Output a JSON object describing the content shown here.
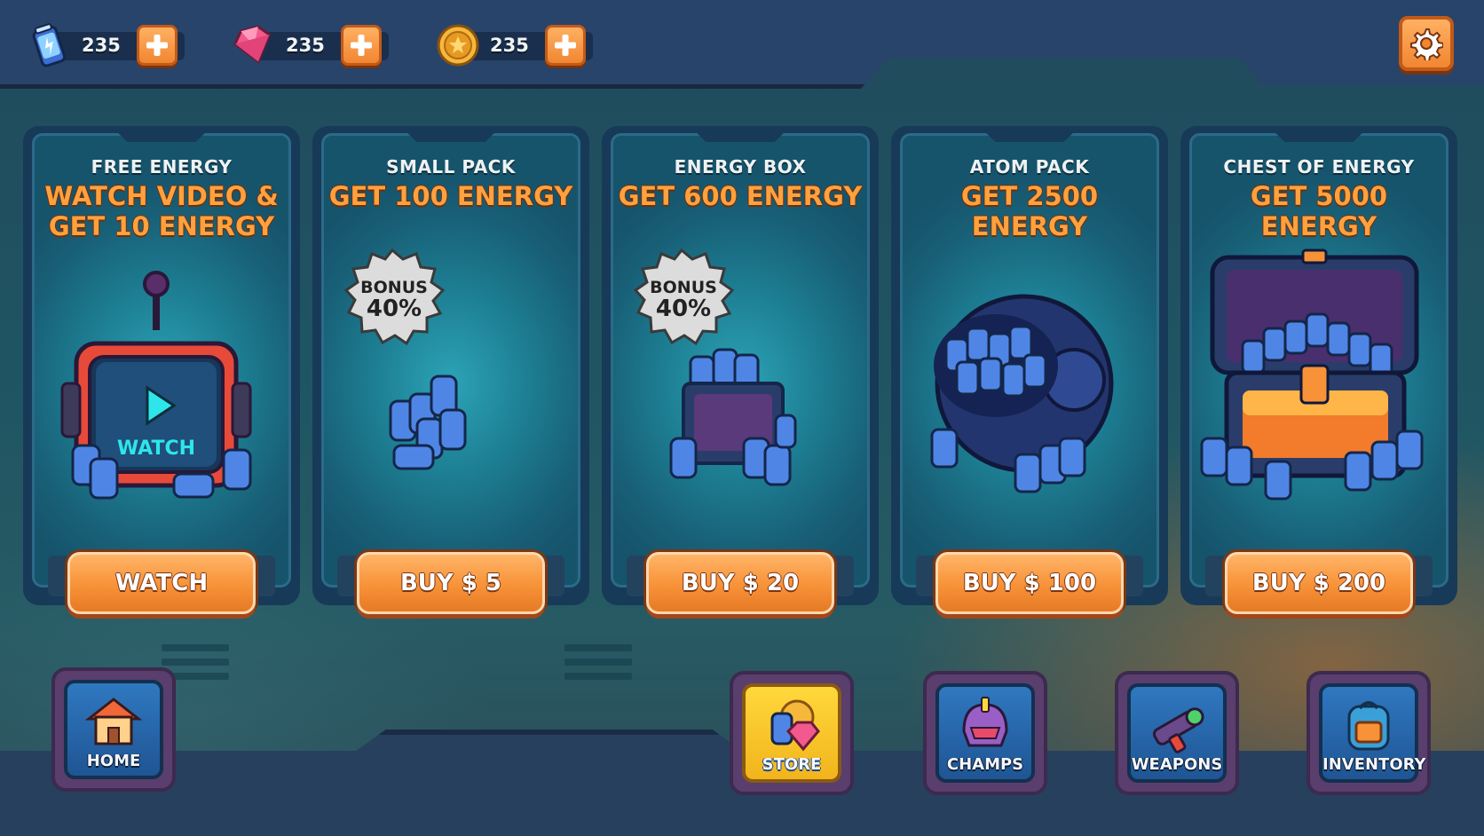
{
  "currencies": [
    {
      "name": "energy",
      "icon": "energy-battery-icon",
      "value": "235"
    },
    {
      "name": "gems",
      "icon": "pink-gem-icon",
      "value": "235"
    },
    {
      "name": "coins",
      "icon": "gold-coin-icon",
      "value": "235"
    }
  ],
  "settings": {
    "icon": "gear-icon"
  },
  "cards": [
    {
      "subtitle": "FREE ENERGY",
      "title_line1": "WATCH VIDEO &",
      "title_line2": "GET 10 ENERGY",
      "button": "WATCH",
      "bonus": ""
    },
    {
      "subtitle": "SMALL PACK",
      "title_line1": "GET 100 ENERGY",
      "title_line2": "",
      "button": "BUY $ 5",
      "bonus_word": "BONUS",
      "bonus_value": "40%"
    },
    {
      "subtitle": "ENERGY BOX",
      "title_line1": "GET 600 ENERGY",
      "title_line2": "",
      "button": "BUY $ 20",
      "bonus_word": "BONUS",
      "bonus_value": "40%"
    },
    {
      "subtitle": "ATOM PACK",
      "title_line1": "GET 2500 ENERGY",
      "title_line2": "",
      "button": "BUY $ 100"
    },
    {
      "subtitle": "CHEST OF ENERGY",
      "title_line1": "GET 5000 ENERGY",
      "title_line2": "",
      "button": "BUY $ 200"
    }
  ],
  "tv_label": "WATCH",
  "nav": [
    {
      "label": "HOME",
      "icon": "home-icon",
      "active": false
    },
    {
      "label": "STORE",
      "icon": "store-icon",
      "active": true
    },
    {
      "label": "CHAMPS",
      "icon": "champs-helmet-icon",
      "active": false
    },
    {
      "label": "WEAPONS",
      "icon": "weapons-blaster-icon",
      "active": false
    },
    {
      "label": "INVENTORY",
      "icon": "inventory-backpack-icon",
      "active": false
    }
  ],
  "colors": {
    "accent_orange": "#f79238",
    "title_orange": "#ffa13e",
    "panel_blue": "#173a58",
    "active_yellow": "#ffd83c"
  }
}
